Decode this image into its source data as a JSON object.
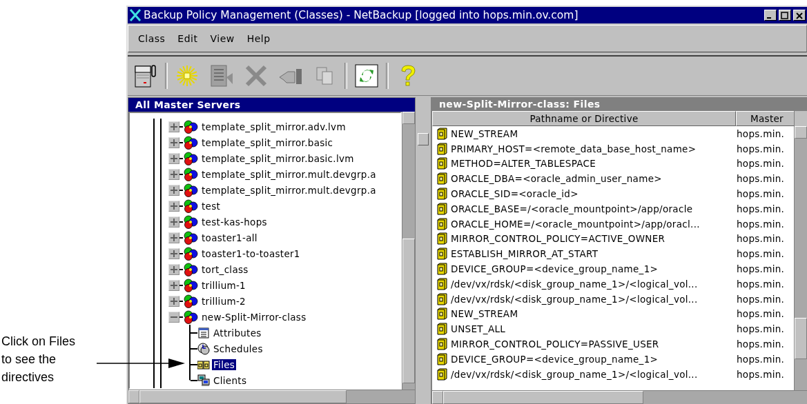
{
  "window": {
    "title": "Backup Policy Management (Classes) - NetBackup [logged into hops.min.ov.com]"
  },
  "menu": [
    "Class",
    "Edit",
    "View",
    "Help"
  ],
  "toolbar": [
    {
      "buttons": [
        {
          "kind": "server",
          "disabled": false
        }
      ]
    },
    {
      "buttons": [
        {
          "kind": "new",
          "disabled": false
        },
        {
          "kind": "edit",
          "disabled": true
        },
        {
          "kind": "delete",
          "disabled": true
        },
        {
          "kind": "hand",
          "disabled": true
        },
        {
          "kind": "copy",
          "disabled": true
        }
      ]
    },
    {
      "buttons": [
        {
          "kind": "refresh",
          "disabled": false
        }
      ]
    },
    {
      "buttons": [
        {
          "kind": "help",
          "disabled": false
        }
      ]
    }
  ],
  "tree": {
    "title": "All Master Servers",
    "items": [
      {
        "label": "template_split_mirror.adv.lvm",
        "expanded": false
      },
      {
        "label": "template_split_mirror.basic",
        "expanded": false
      },
      {
        "label": "template_split_mirror.basic.lvm",
        "expanded": false
      },
      {
        "label": "template_split_mirror.mult.devgrp.a",
        "expanded": false
      },
      {
        "label": "template_split_mirror.mult.devgrp.a",
        "expanded": false
      },
      {
        "label": "test",
        "expanded": false
      },
      {
        "label": "test-kas-hops",
        "expanded": false
      },
      {
        "label": "toaster1-all",
        "expanded": false
      },
      {
        "label": "toaster1-to-toaster1",
        "expanded": false
      },
      {
        "label": "tort_class",
        "expanded": false
      },
      {
        "label": "trillium-1",
        "expanded": false
      },
      {
        "label": "trillium-2",
        "expanded": false
      },
      {
        "label": "new-Split-Mirror-class",
        "expanded": true,
        "children": [
          {
            "label": "Attributes",
            "kind": "attributes",
            "selected": false
          },
          {
            "label": "Schedules",
            "kind": "schedules",
            "selected": false
          },
          {
            "label": "Files",
            "kind": "files",
            "selected": true
          },
          {
            "label": "Clients",
            "kind": "clients",
            "selected": false
          }
        ]
      }
    ]
  },
  "files": {
    "title": "new-Split-Mirror-class: Files",
    "columns": [
      "Pathname or Directive",
      "Master"
    ],
    "rows": [
      [
        "NEW_STREAM",
        "hops.min."
      ],
      [
        "PRIMARY_HOST=<remote_data_base_host_name>",
        "hops.min."
      ],
      [
        "METHOD=ALTER_TABLESPACE",
        "hops.min."
      ],
      [
        "ORACLE_DBA=<oracle_admin_user_name>",
        "hops.min."
      ],
      [
        "ORACLE_SID=<oracle_id>",
        "hops.min."
      ],
      [
        "ORACLE_BASE=/<oracle_mountpoint>/app/oracle",
        "hops.min."
      ],
      [
        "ORACLE_HOME=/<oracle_mountpoint>/app/oracl...",
        "hops.min."
      ],
      [
        "MIRROR_CONTROL_POLICY=ACTIVE_OWNER",
        "hops.min."
      ],
      [
        "ESTABLISH_MIRROR_AT_START",
        "hops.min."
      ],
      [
        "DEVICE_GROUP=<device_group_name_1>",
        "hops.min."
      ],
      [
        "/dev/vx/rdsk/<disk_group_name_1>/<logical_vol...",
        "hops.min."
      ],
      [
        "/dev/vx/rdsk/<disk_group_name_1>/<logical_vol...",
        "hops.min."
      ],
      [
        "NEW_STREAM",
        "hops.min."
      ],
      [
        "UNSET_ALL",
        "hops.min."
      ],
      [
        "MIRROR_CONTROL_POLICY=PASSIVE_USER",
        "hops.min."
      ],
      [
        "DEVICE_GROUP=<device_group_name_1>",
        "hops.min."
      ],
      [
        "/dev/vx/rdsk/<disk_group_name_1>/<logical_vol...",
        "hops.min."
      ]
    ]
  },
  "callout": {
    "text": "Click on Files to see the directives"
  }
}
